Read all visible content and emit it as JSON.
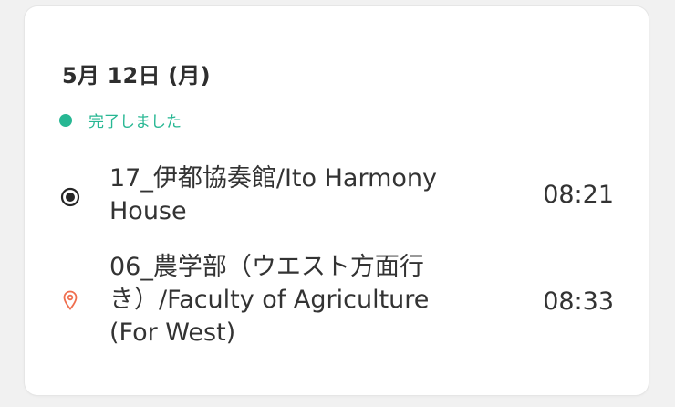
{
  "trip": {
    "date": "5月 12日 (月)",
    "status": {
      "label": "完了しました",
      "color": "#27b793"
    },
    "origin": {
      "name_line1": "17_伊都協奏館/Ito Harmony",
      "name_line2": "House",
      "time": "08:21",
      "icon": "radio-target-icon"
    },
    "destination": {
      "name_line1": "06_農学部（ウエスト方面行",
      "name_line2": "き）/Faculty of Agriculture",
      "name_line3": "(For West)",
      "time": "08:33",
      "icon": "map-pin-icon",
      "icon_color": "#ef6e4e"
    }
  }
}
